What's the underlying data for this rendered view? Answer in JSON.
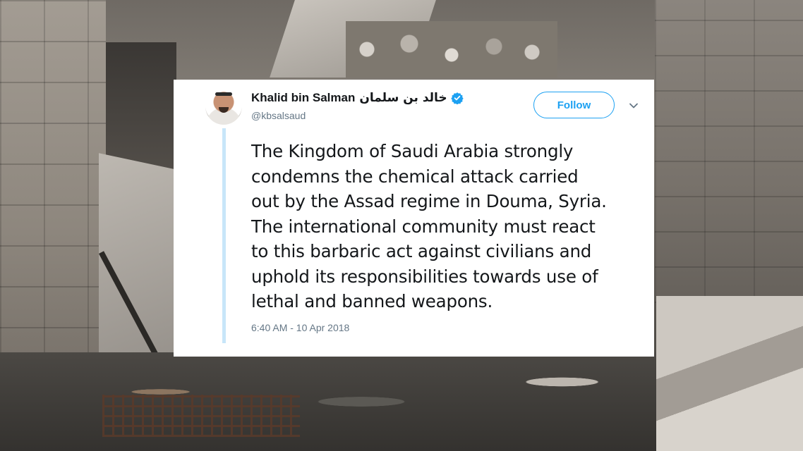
{
  "tweet": {
    "display_name": "Khalid bin Salman",
    "display_name_arabic": "خالد بن سلمان",
    "handle": "@kbsalsaud",
    "verified": true,
    "follow_label": "Follow",
    "text_lines": [
      "The Kingdom of Saudi Arabia strongly",
      "condemns the chemical attack carried",
      "out by the Assad regime in Douma, Syria.",
      "The international community must react",
      "to this barbaric act against civilians and",
      "uphold its responsibilities towards use of",
      "lethal and banned weapons."
    ],
    "timestamp": "6:40 AM - 10 Apr 2018"
  },
  "icons": {
    "verified": "verified-badge-icon",
    "menu": "chevron-down-icon"
  },
  "colors": {
    "accent": "#1da1f2",
    "thread_line": "#c8e6f9",
    "text_primary": "#14171a",
    "text_secondary": "#657786",
    "card_background": "#ffffff"
  }
}
